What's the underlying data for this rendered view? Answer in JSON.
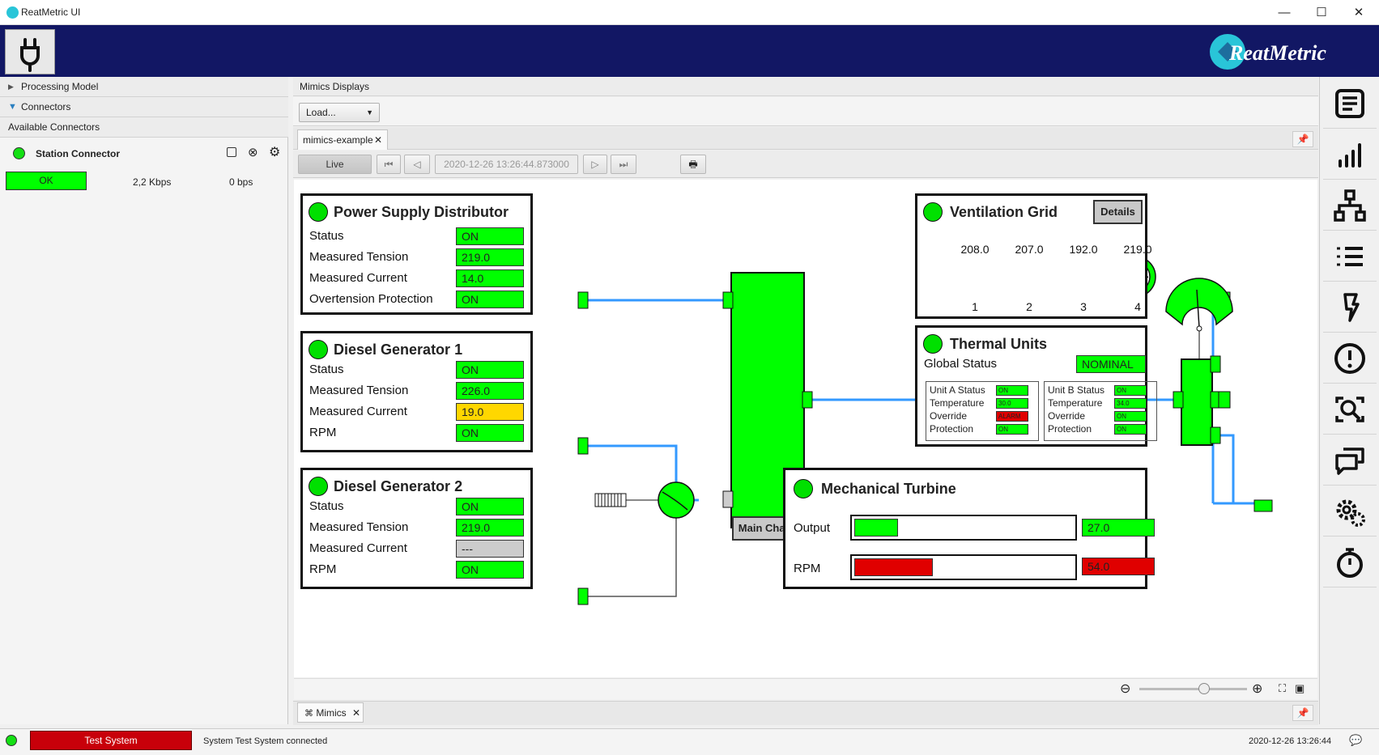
{
  "window": {
    "title": "ReatMetric UI",
    "minimize": "—",
    "maximize": "☐",
    "close": "✕"
  },
  "brand": {
    "logo_text": "ReatMetric"
  },
  "left": {
    "accordion": [
      "Processing Model",
      "Connectors"
    ],
    "section_title": "Available Connectors",
    "connector": {
      "name": "Station Connector",
      "status": "OK",
      "rate_in": "2,2 Kbps",
      "rate_out": "0 bps"
    }
  },
  "center": {
    "header": "Mimics Displays",
    "load_label": "Load...",
    "tab_label": "mimics-example",
    "live_label": "Live",
    "timestamp": "2020-12-26 13:26:44.873000"
  },
  "mimic": {
    "psd": {
      "title": "Power Supply Distributor",
      "rows": [
        {
          "label": "Status",
          "value": "ON",
          "state": "ok"
        },
        {
          "label": "Measured Tension",
          "value": "219.0",
          "state": "ok"
        },
        {
          "label": "Measured Current",
          "value": "14.0",
          "state": "ok"
        },
        {
          "label": "Overtension Protection",
          "value": "ON",
          "state": "ok"
        }
      ]
    },
    "dg1": {
      "title": "Diesel Generator 1",
      "rows": [
        {
          "label": "Status",
          "value": "ON",
          "state": "ok"
        },
        {
          "label": "Measured Tension",
          "value": "226.0",
          "state": "ok"
        },
        {
          "label": "Measured Current",
          "value": "19.0",
          "state": "warn"
        },
        {
          "label": "RPM",
          "value": "ON",
          "state": "ok"
        }
      ]
    },
    "dg2": {
      "title": "Diesel Generator 2",
      "rows": [
        {
          "label": "Status",
          "value": "ON",
          "state": "ok"
        },
        {
          "label": "Measured Tension",
          "value": "219.0",
          "state": "ok"
        },
        {
          "label": "Measured Current",
          "value": "---",
          "state": "na"
        },
        {
          "label": "RPM",
          "value": "ON",
          "state": "ok"
        }
      ]
    },
    "main_charts": "Main Charts",
    "vent": {
      "title": "Ventilation Grid",
      "details": "Details",
      "fans": [
        {
          "value": "208.0",
          "label": "1"
        },
        {
          "value": "207.0",
          "label": "2"
        },
        {
          "value": "192.0",
          "label": "3"
        },
        {
          "value": "219.0",
          "label": "4"
        }
      ]
    },
    "thermal": {
      "title": "Thermal Units",
      "global_label": "Global Status",
      "global_value": "NOMINAL",
      "unit_a": {
        "rows": [
          {
            "label": "Unit A Status",
            "value": "ON",
            "state": "ok"
          },
          {
            "label": "Temperature",
            "value": "30.0",
            "state": "ok"
          },
          {
            "label": "Override",
            "value": "ALARM",
            "state": "alarm"
          },
          {
            "label": "Protection",
            "value": "ON",
            "state": "ok"
          }
        ]
      },
      "unit_b": {
        "rows": [
          {
            "label": "Unit B Status",
            "value": "ON",
            "state": "ok"
          },
          {
            "label": "Temperature",
            "value": "34.0",
            "state": "ok"
          },
          {
            "label": "Override",
            "value": "ON",
            "state": "ok"
          },
          {
            "label": "Protection",
            "value": "ON",
            "state": "ok"
          }
        ]
      }
    },
    "turbine": {
      "title": "Mechanical Turbine",
      "output": {
        "label": "Output",
        "value": "27.0",
        "fill_fraction": 0.2
      },
      "rpm": {
        "label": "RPM",
        "value": "54.0",
        "fill_fraction": 0.36
      }
    }
  },
  "bottom": {
    "tab_label": "Mimics",
    "zoom_fraction": 0.55
  },
  "status": {
    "system": "Test System",
    "message": "System Test System connected",
    "time": "2020-12-26 13:26:44"
  },
  "colors": {
    "ok": "#00ff00",
    "warn": "#ffd700",
    "alarm": "#e00000",
    "na": "#cccccc",
    "pipe": "#3399ff",
    "banner": "#121764"
  }
}
